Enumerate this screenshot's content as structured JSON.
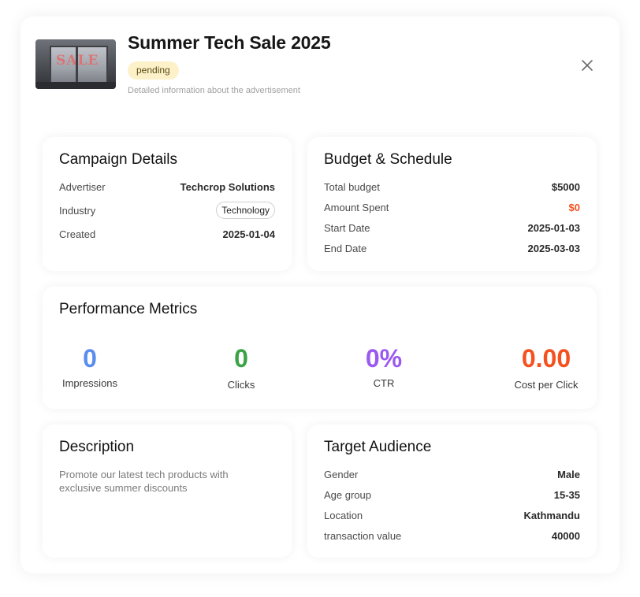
{
  "header": {
    "title": "Summer Tech Sale 2025",
    "status": "pending",
    "subtitle": "Detailed information about the advertisement",
    "thumbnail_text": "SALE"
  },
  "campaign": {
    "heading": "Campaign Details",
    "advertiser_label": "Advertiser",
    "advertiser_value": "Techcrop Solutions",
    "industry_label": "Industry",
    "industry_value": "Technology",
    "created_label": "Created",
    "created_value": "2025-01-04"
  },
  "budget": {
    "heading": "Budget & Schedule",
    "total_label": "Total budget",
    "total_value": "$5000",
    "spent_label": "Amount Spent",
    "spent_value": "$0",
    "start_label": "Start Date",
    "start_value": "2025-01-03",
    "end_label": "End Date",
    "end_value": "2025-03-03"
  },
  "performance": {
    "heading": "Performance Metrics",
    "metrics": [
      {
        "value": "0",
        "label": "Impressions",
        "color": "#5b8def"
      },
      {
        "value": "0",
        "label": "Clicks",
        "color": "#3aa346"
      },
      {
        "value": "0%",
        "label": "CTR",
        "color": "#9b59f0"
      },
      {
        "value": "0.00",
        "label": "Cost per Click",
        "color": "#f4511e"
      }
    ]
  },
  "description": {
    "heading": "Description",
    "text": "Promote our latest tech products with exclusive summer discounts"
  },
  "audience": {
    "heading": "Target Audience",
    "gender_label": "Gender",
    "gender_value": "Male",
    "age_label": "Age group",
    "age_value": "15-35",
    "location_label": "Location",
    "location_value": "Kathmandu",
    "transaction_label": "transaction value",
    "transaction_value": "40000"
  },
  "icons": {
    "close": "close-icon",
    "thumbnail": "sale-storefront-image"
  }
}
